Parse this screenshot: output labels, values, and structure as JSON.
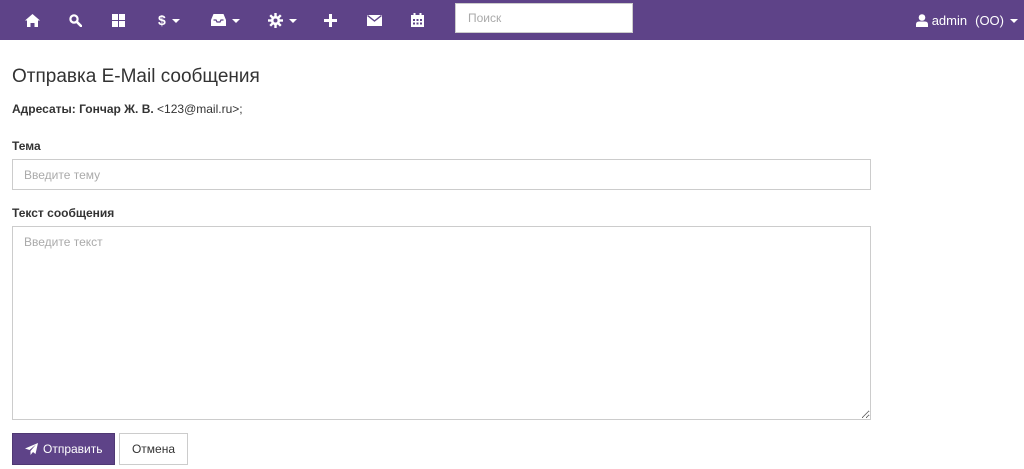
{
  "navbar": {
    "bg_color": "#5e4388",
    "icons": [
      "home-icon",
      "search-icon",
      "dashboard-icon",
      "dollar-icon",
      "inbox-icon",
      "gear-icon",
      "plus-icon",
      "envelope-icon",
      "calendar-icon"
    ],
    "dollar_symbol": "$",
    "search_placeholder": "Поиск",
    "user_name": "admin",
    "user_org": "(OO)"
  },
  "page": {
    "title": "Отправка E-Mail сообщения",
    "recipients_label": "Адресаты:",
    "recipient_name": "Гончар Ж. В.",
    "recipient_email": "<123@mail.ru>;"
  },
  "form": {
    "subject_label": "Тема",
    "subject_placeholder": "Введите тему",
    "subject_value": "",
    "message_label": "Текст сообщения",
    "message_placeholder": "Введите текст",
    "message_value": "",
    "send_label": "Отправить",
    "cancel_label": "Отмена"
  }
}
